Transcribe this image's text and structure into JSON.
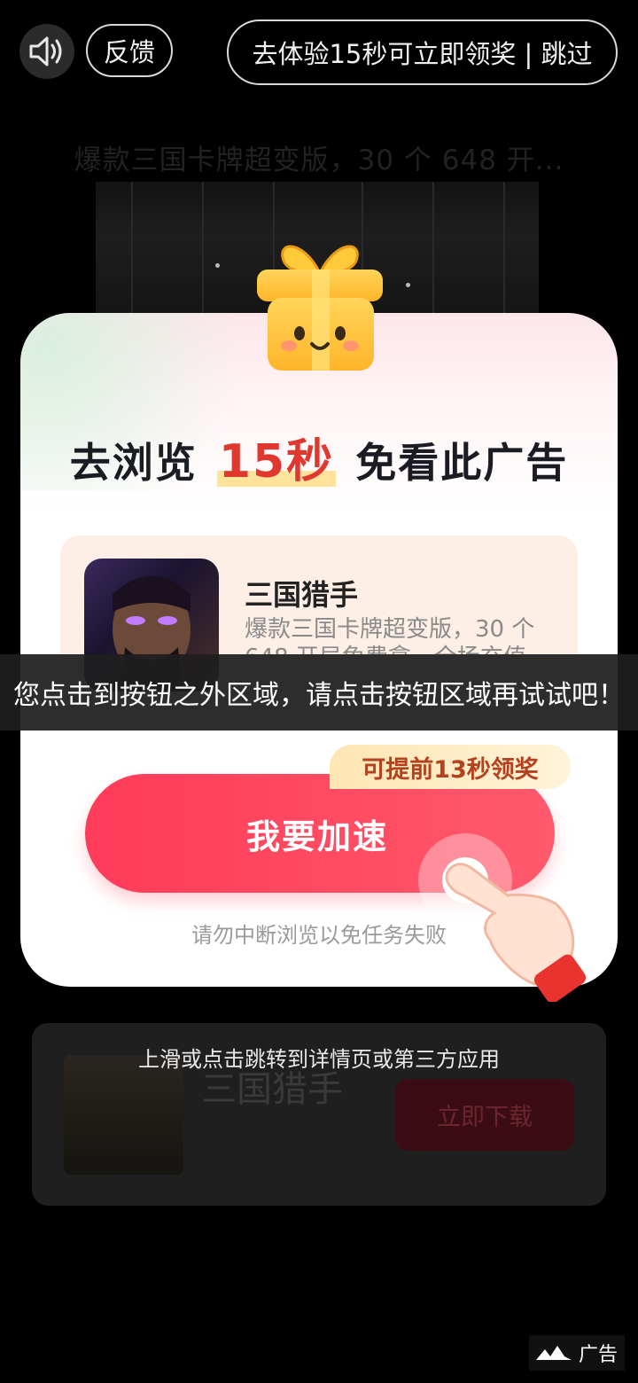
{
  "topbar": {
    "feedback_label": "反馈",
    "skip_label": "去体验15秒可立即领奖 | 跳过"
  },
  "background_ad": {
    "title": "爆款三国卡牌超变版，30 个 648 开..."
  },
  "modal": {
    "headline_prefix": "去浏览",
    "headline_highlight": "15秒",
    "headline_suffix": "免看此广告",
    "app": {
      "name": "三国猎手",
      "description": "爆款三国卡牌超变版，30 个 648 开局免费拿，全场充值"
    },
    "badge": "可提前13秒领奖",
    "cta_label": "我要加速",
    "note": "请勿中断浏览以免任务失败"
  },
  "toast": "您点击到按钮之外区域，请点击按钮区域再试试吧！",
  "bottom_card": {
    "hint": "上滑或点击跳转到详情页或第三方应用",
    "app_name": "三国猎手",
    "download_label": "立即下载"
  },
  "ad_tag": "广告",
  "colors": {
    "accent": "#ff3b5a",
    "highlight": "#e0382f",
    "badge_text": "#b5421e"
  }
}
